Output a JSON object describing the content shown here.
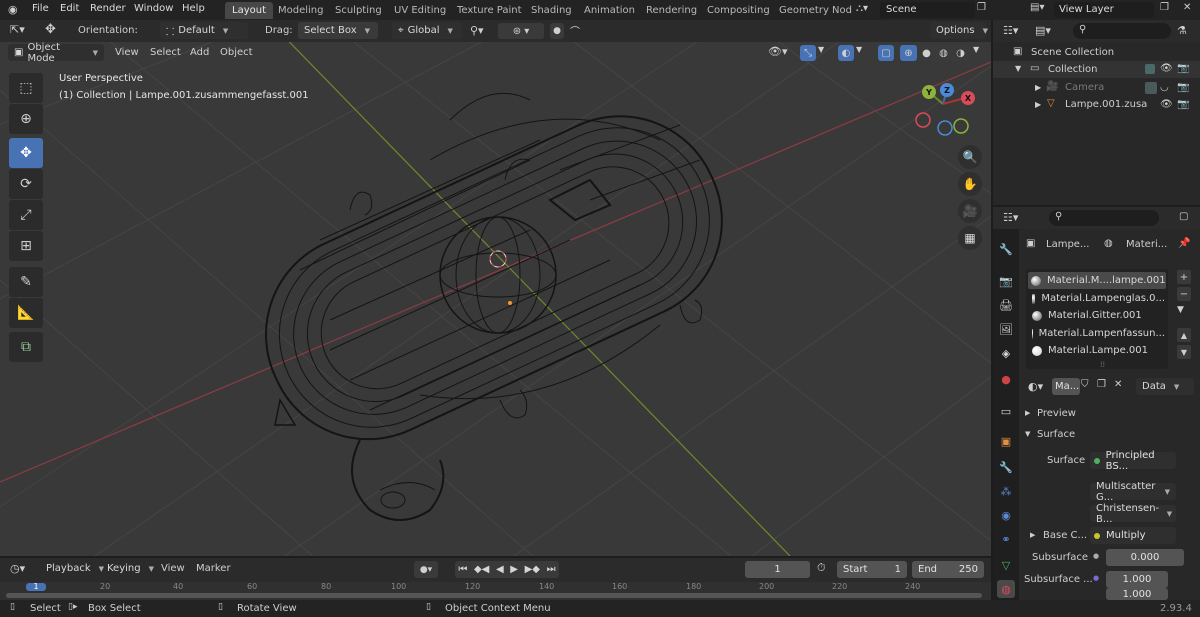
{
  "app": {
    "version": "2.93.4"
  },
  "menu": [
    "File",
    "Edit",
    "Render",
    "Window",
    "Help"
  ],
  "workspaces": [
    "Layout",
    "Modeling",
    "Sculpting",
    "UV Editing",
    "Texture Paint",
    "Shading",
    "Animation",
    "Rendering",
    "Compositing",
    "Geometry Nod"
  ],
  "scene": {
    "name": "Scene",
    "view_layer": "View Layer"
  },
  "viewport_header": {
    "orientation_label": "Orientation:",
    "orientation_value": "Default",
    "drag_label": "Drag:",
    "drag_value": "Select Box",
    "transform_value": "Global",
    "options": "Options",
    "mode": "Object Mode",
    "menus": [
      "View",
      "Select",
      "Add",
      "Object"
    ]
  },
  "overlay_text": {
    "perspective": "User Perspective",
    "collection": "(1) Collection | Lampe.001.zusammengefasst.001"
  },
  "gizmo": {
    "x": "X",
    "y": "Y",
    "z": "Z"
  },
  "outliner": {
    "scene_collection": "Scene Collection",
    "items": [
      "Collection",
      "Camera",
      "Lampe.001.zusa"
    ]
  },
  "properties": {
    "search_placeholder": "",
    "object_name": "Lampe...",
    "material_tab": "Materi...",
    "materials": [
      "Material.M....lampe.001",
      "Material.Lampenglas.0...",
      "Material.Gitter.001",
      "Material.Lampenfassun...",
      "Material.Lampe.001"
    ],
    "slot_name": "Ma...",
    "link": "Data",
    "preview": "Preview",
    "surface_section": "Surface",
    "surface_label": "Surface",
    "surface_value": "Principled BS...",
    "multiscatter": "Multiscatter G...",
    "christensen": "Christensen-B...",
    "base_color_label": "Base C...",
    "base_color_value": "Multiply",
    "subsurface_label": "Subsurface",
    "subsurface_value": "0.000",
    "subsurface2_label": "Subsurface ...",
    "subsurface2_v1": "1.000",
    "subsurface2_v2": "1.000"
  },
  "timeline": {
    "menus": [
      "Playback",
      "Keying",
      "View",
      "Marker"
    ],
    "current_frame": "1",
    "start_label": "Start",
    "start": "1",
    "end_label": "End",
    "end": "250",
    "ruler": [
      "1",
      "20",
      "40",
      "60",
      "80",
      "100",
      "120",
      "140",
      "160",
      "180",
      "200",
      "220",
      "240"
    ]
  },
  "status": {
    "select": "Select",
    "box_select": "Box Select",
    "rotate": "Rotate View",
    "context": "Object Context Menu"
  },
  "colors": {
    "accent": "#4772b3",
    "viewport_bg": "#393939",
    "x_axis": "#c34a58",
    "y_axis": "#8dab32",
    "header": "#2b2b2b",
    "panel": "#282828"
  }
}
